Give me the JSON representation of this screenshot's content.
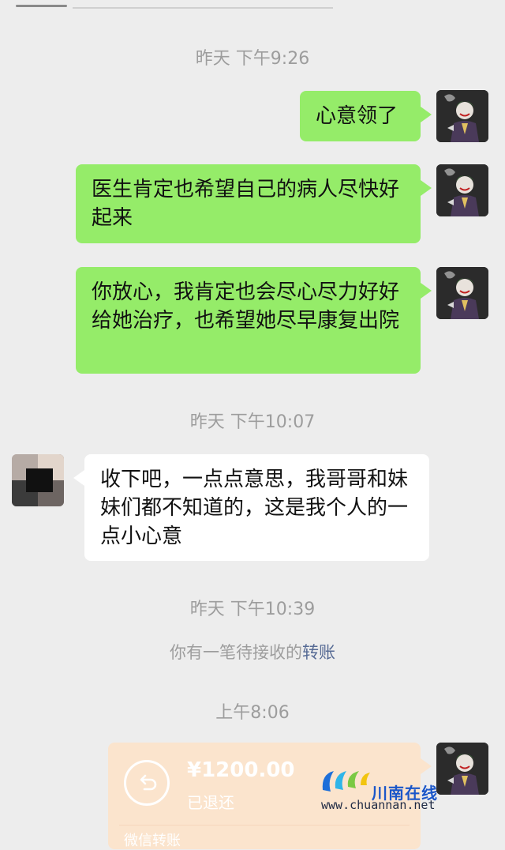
{
  "messages": [
    {
      "type": "time",
      "text": "昨天 下午9:26"
    },
    {
      "type": "me",
      "text": "心意领了"
    },
    {
      "type": "me",
      "text": "医生肯定也希望自己的病人尽快好起来"
    },
    {
      "type": "me",
      "text": "你放心，我肯定也会尽心尽力好好给她治疗，也希望她尽早康复出院"
    },
    {
      "type": "time",
      "text": "昨天 下午10:07"
    },
    {
      "type": "other",
      "text": "收下吧，一点点意思，我哥哥和妹妹们都不知道的，这是我个人的一点小心意"
    },
    {
      "type": "time",
      "text": "昨天 下午10:39"
    },
    {
      "type": "system",
      "text": "你有一笔待接收的",
      "link": "转账"
    },
    {
      "type": "time",
      "text": "上午8:06"
    }
  ],
  "transfer": {
    "amount": "¥1200.00",
    "status": "已退还",
    "footer": "微信转账"
  },
  "watermark": {
    "brand": "川南在线",
    "url": "www.chuannan.net"
  },
  "colors": {
    "background": "#ededed",
    "my_bubble": "#95ec69",
    "other_bubble": "#ffffff",
    "transfer_bubble": "#fbe4cd",
    "link": "#576b95"
  }
}
